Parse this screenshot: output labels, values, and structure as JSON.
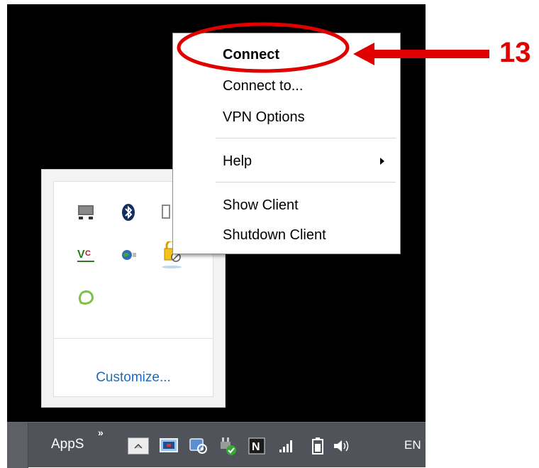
{
  "context_menu": {
    "items": [
      {
        "label": "Connect",
        "bold": true
      },
      {
        "label": "Connect to..."
      },
      {
        "label": "VPN Options"
      },
      {
        "label": "Help",
        "has_submenu": true
      },
      {
        "label": "Show Client"
      },
      {
        "label": "Shutdown Client"
      }
    ]
  },
  "tray_flyout": {
    "icons": [
      "display-icon",
      "bluetooth-icon",
      "partial-icon",
      "vnc-icon",
      "network-globe-icon",
      "vpn-lock-icon",
      "green-chat-icon"
    ],
    "customize_label": "Customize..."
  },
  "taskbar": {
    "toolbar_label": "AppS",
    "chevron": "»",
    "tray_icons": [
      "show-hidden-icons-button",
      "screen-icon",
      "network-settings-icon",
      "power-plug-icon",
      "n-app-icon",
      "signal-bars-icon",
      "battery-icon",
      "volume-icon"
    ],
    "language": "EN"
  },
  "annotation": {
    "step_number": "13",
    "color": "#e00000"
  }
}
